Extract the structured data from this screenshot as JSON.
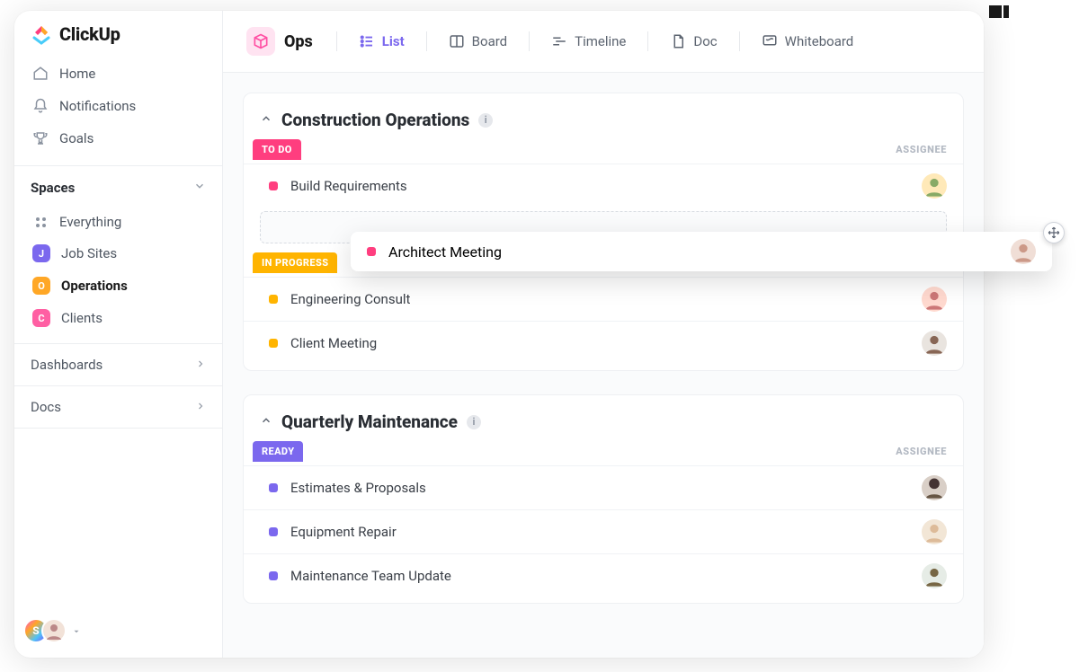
{
  "brand": {
    "name": "ClickUp"
  },
  "sidebar": {
    "nav": [
      {
        "label": "Home"
      },
      {
        "label": "Notifications"
      },
      {
        "label": "Goals"
      }
    ],
    "spaces_header": "Spaces",
    "everything_label": "Everything",
    "spaces": [
      {
        "letter": "J",
        "label": "Job Sites",
        "color": "#7b68ee"
      },
      {
        "letter": "O",
        "label": "Operations",
        "color": "#ffa726",
        "active": true
      },
      {
        "letter": "C",
        "label": "Clients",
        "color": "#ff5fa3"
      }
    ],
    "sections": [
      {
        "label": "Dashboards"
      },
      {
        "label": "Docs"
      }
    ],
    "footer_user_initial": "S"
  },
  "topbar": {
    "space_name": "Ops",
    "views": [
      {
        "label": "List",
        "active": true
      },
      {
        "label": "Board"
      },
      {
        "label": "Timeline"
      },
      {
        "label": "Doc"
      },
      {
        "label": "Whiteboard"
      }
    ]
  },
  "lists": [
    {
      "title": "Construction Operations",
      "groups": [
        {
          "status": "TO DO",
          "color": "#ff3e7f",
          "assignee_header": "ASSIGNEE",
          "tasks": [
            {
              "name": "Build Requirements",
              "dot": "#ff3e7f",
              "avatar_bg": "#ffe9b8"
            }
          ],
          "has_dropzone": true
        },
        {
          "status": "IN PROGRESS",
          "color": "#ffb400",
          "tasks": [
            {
              "name": "Engineering Consult",
              "dot": "#ffb400",
              "avatar_bg": "#ffd9cf"
            },
            {
              "name": "Client Meeting",
              "dot": "#ffb400",
              "avatar_bg": "#e9e4df"
            }
          ]
        }
      ]
    },
    {
      "title": "Quarterly Maintenance",
      "groups": [
        {
          "status": "READY",
          "color": "#7b68ee",
          "assignee_header": "ASSIGNEE",
          "tasks": [
            {
              "name": "Estimates & Proposals",
              "dot": "#7b68ee",
              "avatar_bg": "#d9cfc7"
            },
            {
              "name": "Equipment Repair",
              "dot": "#7b68ee",
              "avatar_bg": "#f2e6d6"
            },
            {
              "name": "Maintenance Team Update",
              "dot": "#7b68ee",
              "avatar_bg": "#e6ece6"
            }
          ]
        }
      ]
    }
  ],
  "dragging_task": {
    "name": "Architect Meeting",
    "dot": "#ff3e7f",
    "avatar_bg": "#f0ded6"
  }
}
